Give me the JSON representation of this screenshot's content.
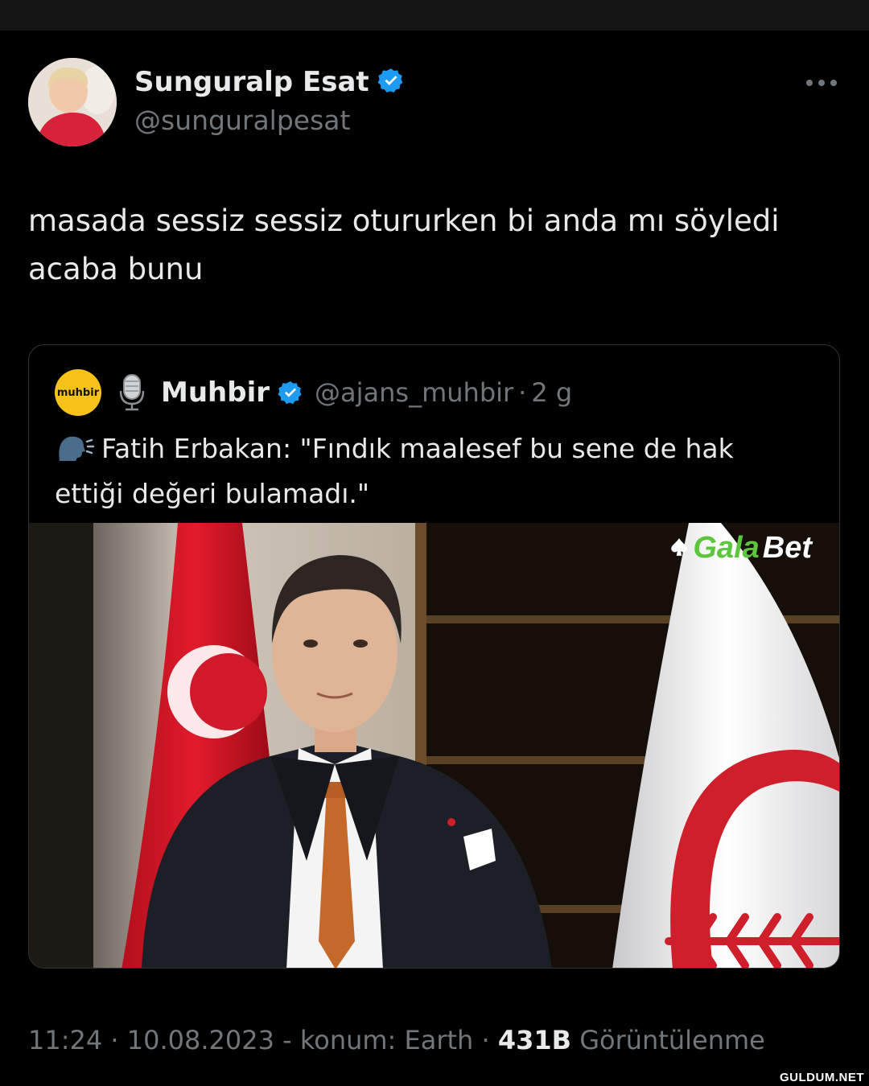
{
  "tweet": {
    "author_name": "Sunguralp Esat",
    "author_handle": "@sunguralpesat",
    "text_line1": "masada sessiz sessiz otururken bi anda mı söyledi",
    "text_line2": "acaba bunu"
  },
  "quoted": {
    "avatar_label": "muhbir",
    "name": "Muhbir",
    "handle": "@ajans_muhbir",
    "separator": "·",
    "time": "2 g",
    "text_line1": "Fatih Erbakan: \"Fındık maalesef bu sene de hak",
    "text_line2": "ettiği değeri bulamadı.\"",
    "watermark_part1": "Gala",
    "watermark_part2": "Bet"
  },
  "meta": {
    "time": "11:24",
    "sep1": "·",
    "date": "10.08.2023",
    "location": "- konum: Earth",
    "sep2": "·",
    "views": "431B",
    "views_label": "Görüntülenme"
  },
  "site_watermark": "GULDUM.NET",
  "colors": {
    "background": "#000000",
    "text": "#e7e9ea",
    "secondary": "#71767b",
    "verified": "#1d9bf0",
    "border": "#2f3336"
  },
  "icons": [
    "verified-badge-icon",
    "more-icon",
    "microphone-icon",
    "speaking-head-icon",
    "spade-icon"
  ]
}
